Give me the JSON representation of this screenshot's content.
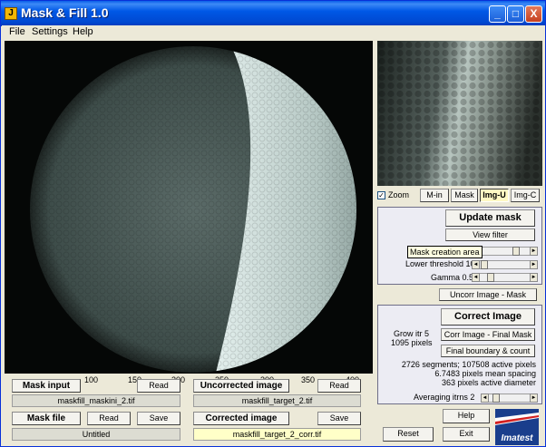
{
  "window": {
    "title": "Mask & Fill 1.0",
    "app_icon": "J",
    "controls": {
      "minimize": "_",
      "maximize": "□",
      "close": "X"
    }
  },
  "menu": {
    "items": [
      "File",
      "Settings",
      "Help"
    ]
  },
  "axis_ticks": [
    "100",
    "150",
    "200",
    "250",
    "300",
    "350",
    "400"
  ],
  "zoom": {
    "checkbox_label": "Zoom",
    "checked": true
  },
  "view_buttons": {
    "m_in": "M-in",
    "mask": "Mask",
    "img_u": "Img-U",
    "img_c": "Img-C",
    "selected": "Img-U"
  },
  "mask_panel": {
    "update_mask": "Update mask",
    "view_filter": "View filter",
    "tooltip": "Mask creation area",
    "lower_threshold_label": "Lower threshold 10",
    "gamma_label": "Gamma 0.5"
  },
  "uncorr_mask_button": "Uncorr Image - Mask",
  "correct_panel": {
    "correct_image": "Correct Image",
    "grow_itr_label": "Grow itr 5",
    "pixels_label": "1095 pixels",
    "corr_final_mask": "Corr Image - Final Mask",
    "final_boundary": "Final boundary & count",
    "stats_line1": "2726 segments;  107508 active pixels",
    "stats_line2": "6.7483 pixels mean spacing",
    "stats_line3": "363 pixels active diameter",
    "averaging_label": "Averaging itrns 2"
  },
  "bottom": {
    "mask_input": "Mask input",
    "read": "Read",
    "mask_input_file": "maskfill_maskini_2.tif",
    "mask_file": "Mask file",
    "save": "Save",
    "mask_file_value": "Untitled",
    "uncorrected_image": "Uncorrected image",
    "uncorrected_file": "maskfill_target_2.tif",
    "corrected_image": "Corrected image",
    "corrected_file": "maskfill_target_2_corr.tif"
  },
  "help_button": "Help",
  "reset_button": "Reset",
  "exit_button": "Exit",
  "logo_text": "Imatest",
  "colors": {
    "titlebar": "#0054e3",
    "dark_half": "#4a5a56",
    "light_half": "#b8ccc8",
    "background": "#050706"
  }
}
